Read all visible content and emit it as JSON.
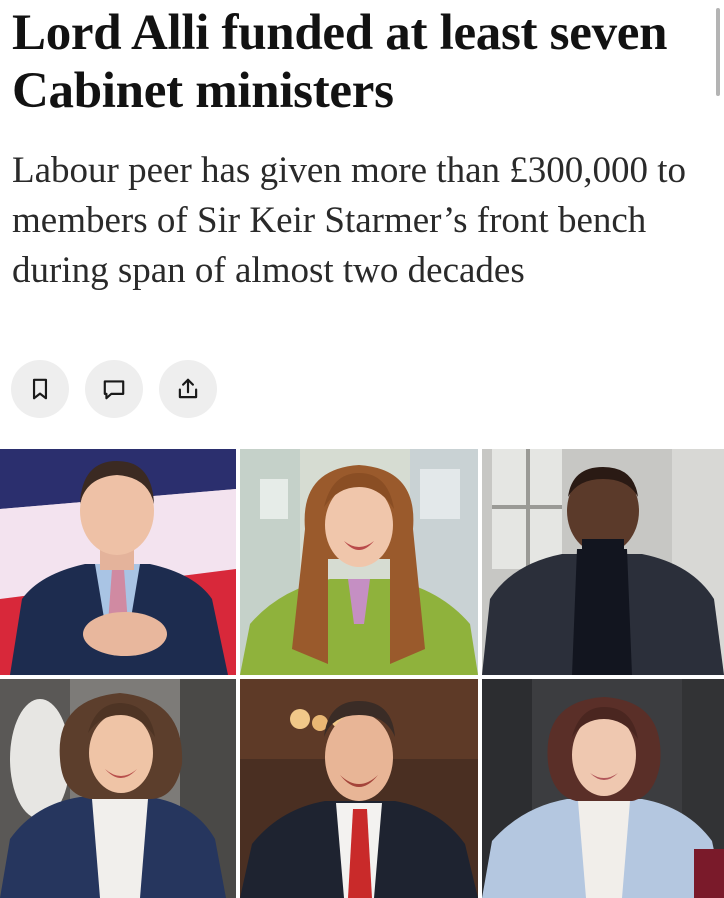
{
  "article": {
    "headline": "Lord Alli funded at least seven Cabinet ministers",
    "standfirst": "Labour peer has given more than £300,000 to members of Sir Keir Starmer’s front bench during span of almost two decades"
  },
  "actions": [
    {
      "name": "bookmark",
      "icon": "bookmark-icon"
    },
    {
      "name": "comment",
      "icon": "comment-icon"
    },
    {
      "name": "share",
      "icon": "share-icon"
    }
  ],
  "photos": [
    {
      "subject": "man in navy suit and pink tie, hands clasped, red and white backdrop"
    },
    {
      "subject": "smiling woman with long auburn hair in green coat"
    },
    {
      "subject": "man in black turtleneck and dark jacket by a window"
    },
    {
      "subject": "smiling woman with curly hair in navy blazer"
    },
    {
      "subject": "smiling man in dark suit with red tie"
    },
    {
      "subject": "woman with shoulder-length hair in light blue blazer"
    }
  ],
  "colors": {
    "text": "#121212",
    "button_bg": "#eeeeee",
    "icon": "#1a1a1a"
  }
}
